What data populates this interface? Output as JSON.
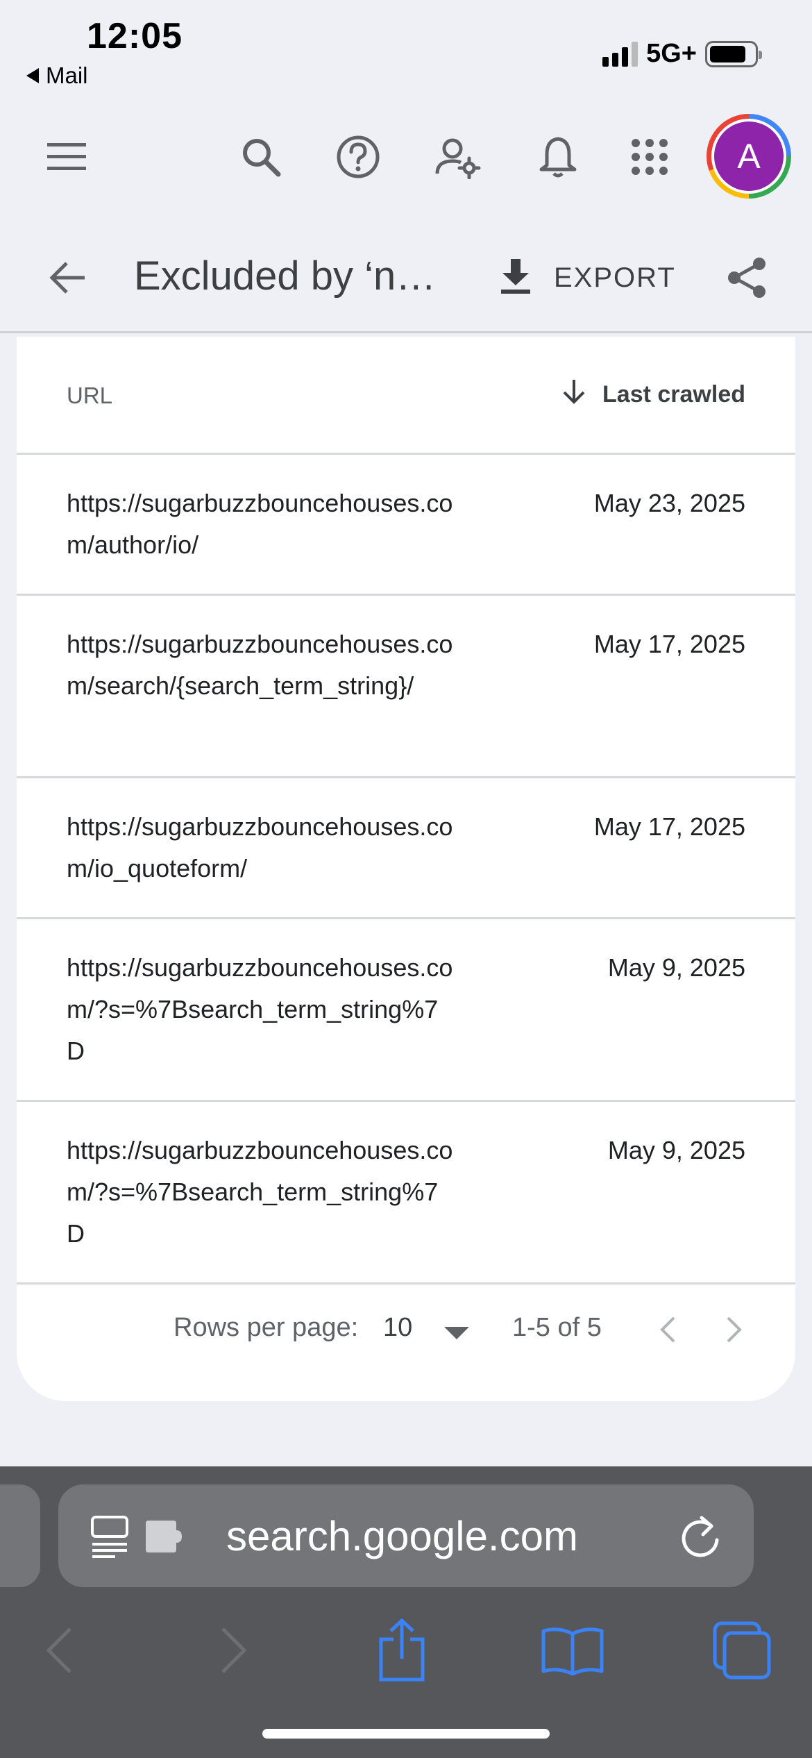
{
  "status_bar": {
    "time": "12:05",
    "back_label": "Mail",
    "network": "5G+"
  },
  "toolbar": {
    "icons": [
      "menu-icon",
      "search-icon",
      "help-icon",
      "manage-users-icon",
      "notifications-icon",
      "apps-icon"
    ],
    "avatar_letter": "A",
    "avatar_color": "#8e24aa"
  },
  "page_header": {
    "title": "Excluded by ‘n…",
    "export_label": "EXPORT"
  },
  "table": {
    "columns": {
      "url": "URL",
      "last_crawled": "Last crawled"
    },
    "rows": [
      {
        "url": "https://sugarbuzzbouncehouses.com/author/io/",
        "date": "May 23, 2025"
      },
      {
        "url": "https://sugarbuzzbouncehouses.com/search/{search_term_string}/",
        "date": "May 17, 2025"
      },
      {
        "url": "https://sugarbuzzbouncehouses.com/io_quoteform/",
        "date": "May 17, 2025"
      },
      {
        "url": "https://sugarbuzzbouncehouses.com/?s=%7Bsearch_term_string%7D",
        "date": "May 9, 2025"
      },
      {
        "url": "https://sugarbuzzbouncehouses.com/?s=%7Bsearch_term_string%7D",
        "date": "May 9, 2025"
      }
    ],
    "footer": {
      "rows_per_page_label": "Rows per page:",
      "rows_per_page_value": "10",
      "range": "1-5 of 5"
    }
  },
  "browser": {
    "url": "search.google.com"
  }
}
